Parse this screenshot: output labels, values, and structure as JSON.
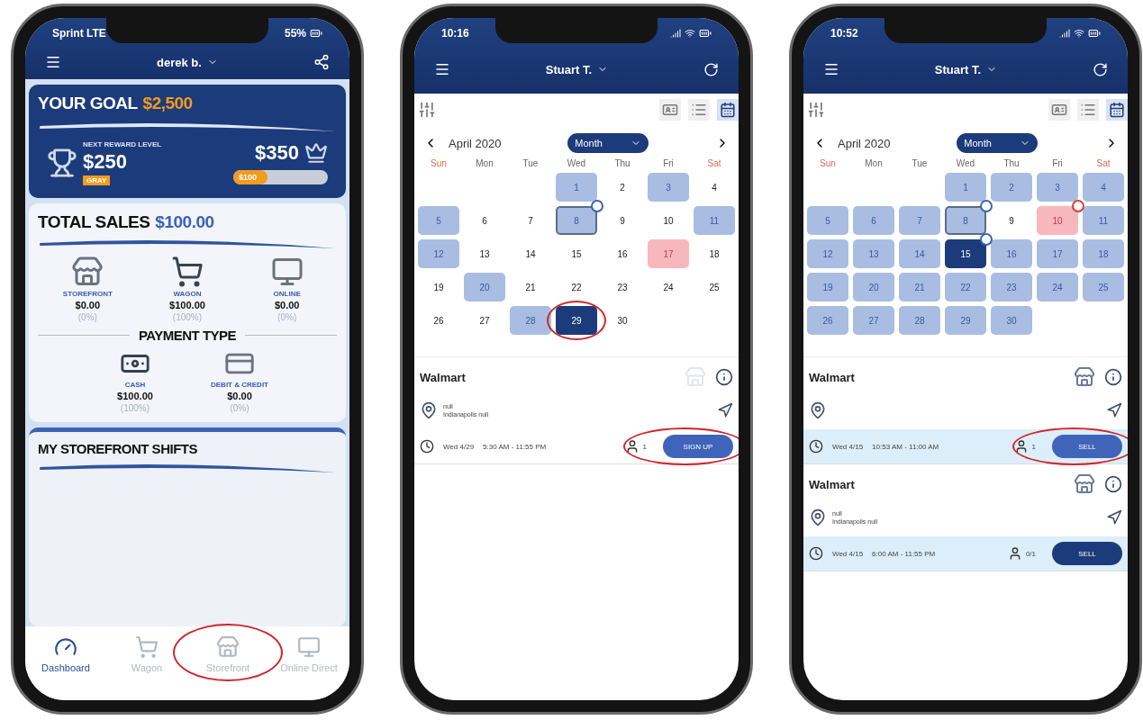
{
  "phones": [
    {
      "kind": "dashboard",
      "status_bar": {
        "carrier": "Sprint LTE",
        "battery": "55%"
      },
      "header": {
        "user": "derek b."
      },
      "goal": {
        "label": "YOUR GOAL",
        "amount": "$2,500",
        "next_label": "NEXT REWARD LEVEL",
        "next_amount": "$250",
        "next_tier": "GRAY",
        "target": "$350",
        "progress": {
          "label": "$100",
          "level": 0.36
        }
      },
      "total_sales": {
        "label": "TOTAL SALES",
        "amount": "$100.00",
        "channels": [
          {
            "kind": "storefront",
            "name": "STOREFRONT",
            "amount": "$0.00",
            "share": "(0%)"
          },
          {
            "kind": "wagon",
            "name": "WAGON",
            "amount": "$100.00",
            "share": "(100%)"
          },
          {
            "kind": "online",
            "name": "ONLINE",
            "amount": "$0.00",
            "share": "(0%)"
          }
        ]
      },
      "payment": {
        "title": "PAYMENT TYPE",
        "types": [
          {
            "kind": "cash",
            "name": "CASH",
            "amount": "$100.00",
            "share": "(100%)"
          },
          {
            "kind": "card",
            "name": "DEBIT & CREDIT",
            "amount": "$0.00",
            "share": "(0%)"
          }
        ]
      },
      "shifts": {
        "title": "MY STOREFRONT SHIFTS"
      },
      "tabs": [
        {
          "kind": "dashboard",
          "label": "Dashboard",
          "selected": true
        },
        {
          "kind": "wagon",
          "label": "Wagon",
          "selected": false
        },
        {
          "kind": "storefront",
          "label": "Storefront",
          "selected": false,
          "highlighted": true
        },
        {
          "kind": "online",
          "label": "Online Direct",
          "selected": false
        }
      ]
    },
    {
      "kind": "calendar",
      "status_bar": {
        "time": "10:16"
      },
      "header": {
        "user": "Stuart T."
      },
      "month": "April 2020",
      "view": "Month",
      "weekdays": [
        {
          "label": "Sun",
          "weekend": true
        },
        {
          "label": "Mon",
          "weekend": false
        },
        {
          "label": "Tue",
          "weekend": false
        },
        {
          "label": "Wed",
          "weekend": false
        },
        {
          "label": "Thu",
          "weekend": false
        },
        {
          "label": "Fri",
          "weekend": false
        },
        {
          "label": "Sat",
          "weekend": true
        }
      ],
      "weeks": [
        [
          {
            "kind": "blank"
          },
          {
            "kind": "blank"
          },
          {
            "kind": "blank"
          },
          {
            "kind": "shift",
            "label": "1"
          },
          {
            "kind": "plain",
            "label": "2"
          },
          {
            "kind": "shift",
            "label": "3"
          },
          {
            "kind": "plain",
            "label": "4"
          }
        ],
        [
          {
            "kind": "shift",
            "label": "5"
          },
          {
            "kind": "plain",
            "label": "6"
          },
          {
            "kind": "plain",
            "label": "7"
          },
          {
            "kind": "shift",
            "label": "8",
            "today": true,
            "badge": true
          },
          {
            "kind": "plain",
            "label": "9"
          },
          {
            "kind": "plain",
            "label": "10"
          },
          {
            "kind": "shift",
            "label": "11"
          }
        ],
        [
          {
            "kind": "shift",
            "label": "12"
          },
          {
            "kind": "plain",
            "label": "13"
          },
          {
            "kind": "plain",
            "label": "14"
          },
          {
            "kind": "plain",
            "label": "15"
          },
          {
            "kind": "plain",
            "label": "16"
          },
          {
            "kind": "alert",
            "label": "17"
          },
          {
            "kind": "plain",
            "label": "18"
          }
        ],
        [
          {
            "kind": "plain",
            "label": "19"
          },
          {
            "kind": "shift",
            "label": "20"
          },
          {
            "kind": "plain",
            "label": "21"
          },
          {
            "kind": "plain",
            "label": "22"
          },
          {
            "kind": "plain",
            "label": "23"
          },
          {
            "kind": "plain",
            "label": "24"
          },
          {
            "kind": "plain",
            "label": "25"
          }
        ],
        [
          {
            "kind": "plain",
            "label": "26"
          },
          {
            "kind": "plain",
            "label": "27"
          },
          {
            "kind": "shift",
            "label": "28"
          },
          {
            "kind": "selected",
            "label": "29",
            "highlighted": true
          },
          {
            "kind": "plain",
            "label": "30"
          }
        ]
      ],
      "shift_cards": [
        {
          "store": "Walmart",
          "store_icon_faded": true,
          "address": [
            "null",
            "Indianapolis null"
          ],
          "date": "Wed 4/29",
          "time": "5:30 AM - 11:55 PM",
          "count": "1",
          "button": "SIGN UP",
          "booked": false,
          "highlighted": true
        }
      ]
    },
    {
      "kind": "calendar",
      "status_bar": {
        "time": "10:52"
      },
      "header": {
        "user": "Stuart T."
      },
      "month": "April 2020",
      "view": "Month",
      "weekdays": [
        {
          "label": "Sun",
          "weekend": true
        },
        {
          "label": "Mon",
          "weekend": false
        },
        {
          "label": "Tue",
          "weekend": false
        },
        {
          "label": "Wed",
          "weekend": false
        },
        {
          "label": "Thu",
          "weekend": false
        },
        {
          "label": "Fri",
          "weekend": false
        },
        {
          "label": "Sat",
          "weekend": true
        }
      ],
      "weeks": [
        [
          {
            "kind": "blank"
          },
          {
            "kind": "blank"
          },
          {
            "kind": "blank"
          },
          {
            "kind": "shift",
            "label": "1"
          },
          {
            "kind": "shift",
            "label": "2"
          },
          {
            "kind": "shift",
            "label": "3"
          },
          {
            "kind": "shift",
            "label": "4"
          }
        ],
        [
          {
            "kind": "shift",
            "label": "5"
          },
          {
            "kind": "shift",
            "label": "6"
          },
          {
            "kind": "shift",
            "label": "7"
          },
          {
            "kind": "shift",
            "label": "8",
            "today": true,
            "badge": true
          },
          {
            "kind": "plain",
            "label": "9"
          },
          {
            "kind": "alert",
            "label": "10",
            "badge": true
          },
          {
            "kind": "shift",
            "label": "11"
          }
        ],
        [
          {
            "kind": "shift",
            "label": "12"
          },
          {
            "kind": "shift",
            "label": "13"
          },
          {
            "kind": "shift",
            "label": "14"
          },
          {
            "kind": "selected",
            "label": "15",
            "badge": true
          },
          {
            "kind": "shift",
            "label": "16"
          },
          {
            "kind": "shift",
            "label": "17"
          },
          {
            "kind": "shift",
            "label": "18"
          }
        ],
        [
          {
            "kind": "shift",
            "label": "19"
          },
          {
            "kind": "shift",
            "label": "20"
          },
          {
            "kind": "shift",
            "label": "21"
          },
          {
            "kind": "shift",
            "label": "22"
          },
          {
            "kind": "shift",
            "label": "23"
          },
          {
            "kind": "shift",
            "label": "24"
          },
          {
            "kind": "shift",
            "label": "25"
          }
        ],
        [
          {
            "kind": "shift",
            "label": "26"
          },
          {
            "kind": "shift",
            "label": "27"
          },
          {
            "kind": "shift",
            "label": "28"
          },
          {
            "kind": "shift",
            "label": "29"
          },
          {
            "kind": "shift",
            "label": "30"
          }
        ]
      ],
      "shift_cards": [
        {
          "store": "Walmart",
          "store_icon_faded": false,
          "date": "Wed 4/15",
          "time": "10:53 AM - 11:00 AM",
          "count": "1",
          "button": "SELL",
          "booked": true,
          "highlighted": true
        },
        {
          "store": "Walmart",
          "store_icon_faded": false,
          "address": [
            "null",
            "Indianapolis null"
          ],
          "date": "Wed 4/15",
          "time": "6:00 AM - 11:55 PM",
          "count": "0/1",
          "button": "SELL",
          "booked": true
        }
      ]
    }
  ]
}
